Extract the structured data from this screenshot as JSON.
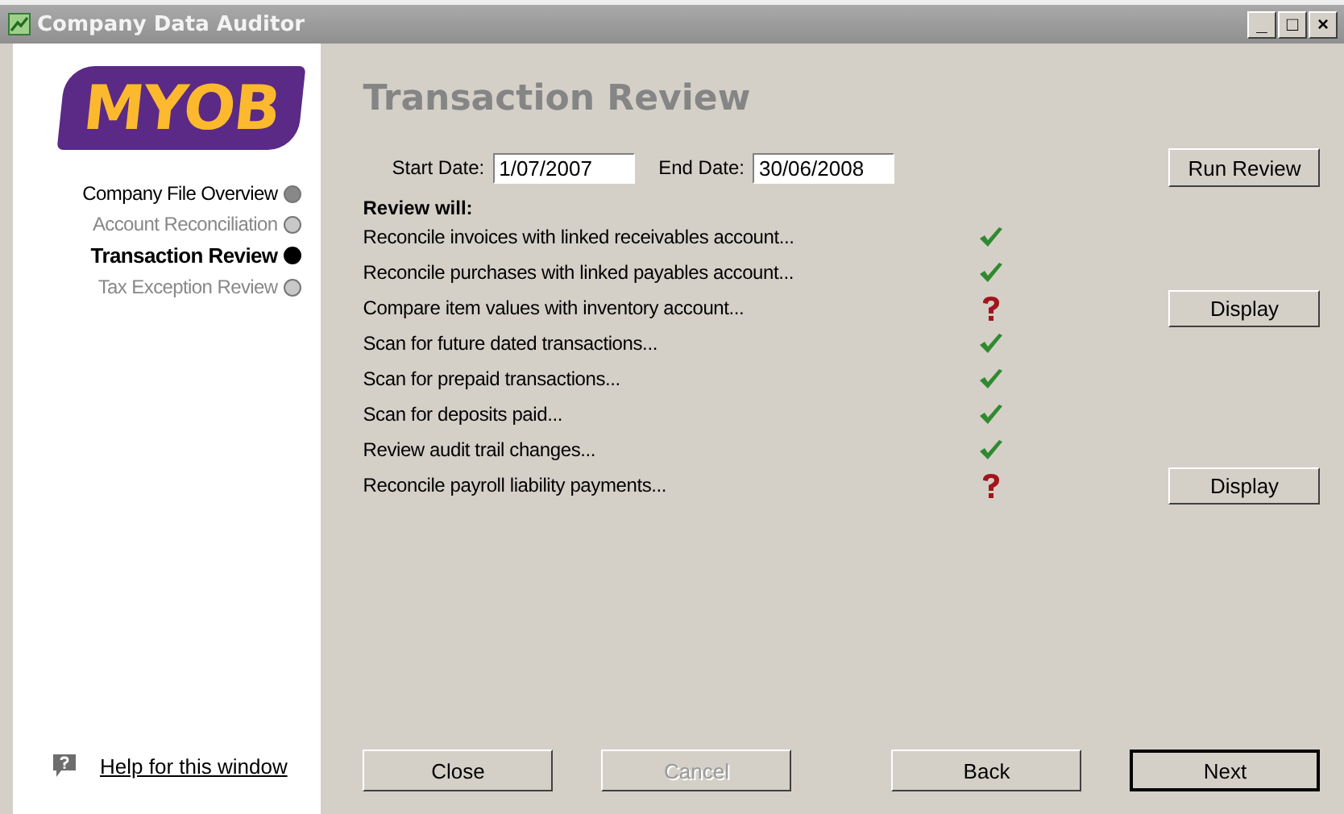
{
  "window": {
    "title": "Company Data Auditor",
    "controls": [
      "_",
      "□",
      "×"
    ]
  },
  "sidebar": {
    "logo": "MYOB",
    "steps": [
      {
        "label": "Company File Overview",
        "kind": "done"
      },
      {
        "label": "Account Reconciliation",
        "kind": "pending"
      },
      {
        "label": "Transaction Review",
        "kind": "current"
      },
      {
        "label": "Tax Exception Review",
        "kind": "pending"
      }
    ],
    "help_link": "Help for this window"
  },
  "main": {
    "heading": "Transaction Review",
    "start_label": "Start Date:",
    "start_value": "1/07/2007",
    "end_label": "End Date:",
    "end_value": "30/06/2008",
    "run_button": "Run Review",
    "review_heading": "Review will:",
    "checks": [
      {
        "label": "Reconcile invoices with linked receivables account...",
        "kind": "pass"
      },
      {
        "label": "Reconcile purchases with linked payables account...",
        "kind": "pass"
      },
      {
        "label": "Compare item values with inventory account...",
        "kind": "issue",
        "button": "Display"
      },
      {
        "label": "Scan for future dated transactions...",
        "kind": "pass"
      },
      {
        "label": "Scan for prepaid transactions...",
        "kind": "pass"
      },
      {
        "label": "Scan for deposits paid...",
        "kind": "pass"
      },
      {
        "label": "Review audit trail changes...",
        "kind": "pass"
      },
      {
        "label": "Reconcile payroll liability payments...",
        "kind": "issue",
        "button": "Display"
      }
    ]
  },
  "footer": {
    "buttons": [
      {
        "label": "Close",
        "disabled": false,
        "default": false
      },
      {
        "label": "Cancel",
        "disabled": true,
        "default": false
      },
      {
        "label": "Back",
        "disabled": false,
        "default": false
      },
      {
        "label": "Next",
        "disabled": false,
        "default": true
      }
    ]
  }
}
